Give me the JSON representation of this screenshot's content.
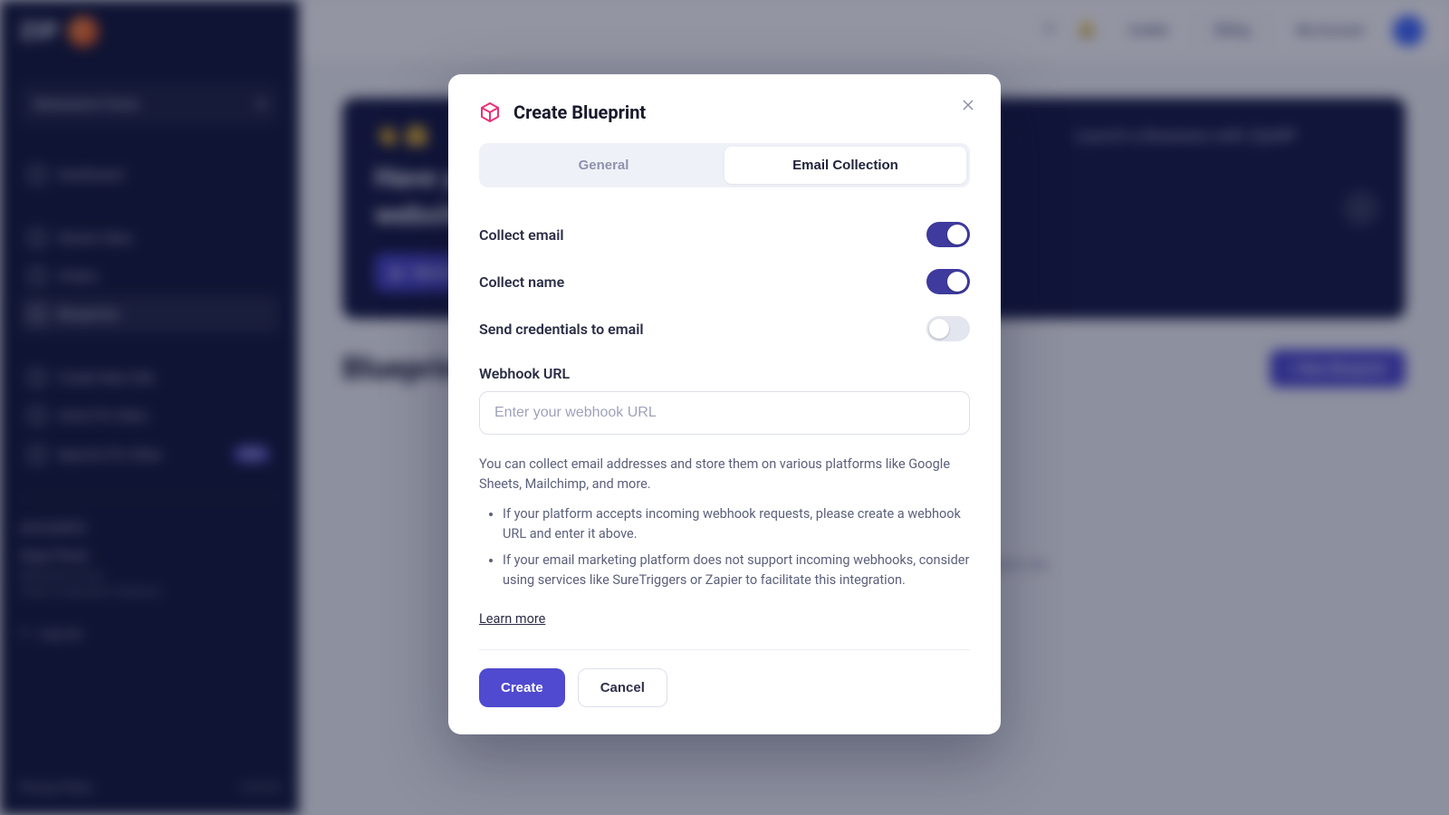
{
  "sidebar": {
    "logo_text": "ZIP",
    "site_selector": "Brainstorm Force",
    "items": [
      {
        "label": "Dashboard"
      },
      {
        "label": "Starter Sites"
      },
      {
        "label": "Orders"
      },
      {
        "label": "Blueprints"
      },
      {
        "label": "Create New Site"
      },
      {
        "label": "Astra Pro Sites"
      },
      {
        "label": "Spectra Pro Sites",
        "badge": "NEW"
      }
    ],
    "account": {
      "section": "ACCOUNTS",
      "name": "Sujay Pawar",
      "org_line1": "Brainstorm Force",
      "org_line2": "(Team of Idea Box Creations)",
      "logout": "Log out"
    },
    "footer": {
      "left": "Privacy Policy",
      "right": "v1.0.12"
    }
  },
  "topbar": {
    "credits": "Credits",
    "billing": "Billing",
    "my_account": "My Account"
  },
  "hero": {
    "emoji": "👋 🤗",
    "line1": "Have you ever wanted to build",
    "line2": "websites using AI?",
    "cta": "Watch Now",
    "right_line": "Launch a Business with ZipWP"
  },
  "section": {
    "title": "Blueprints",
    "new_btn": "+ New Blueprint",
    "empty": "It seems that you haven't created any Blueprint, create one."
  },
  "dialog": {
    "title": "Create Blueprint",
    "tabs": {
      "general": "General",
      "email": "Email Collection",
      "active": "email"
    },
    "toggles": {
      "collect_email": {
        "label": "Collect email",
        "on": true
      },
      "collect_name": {
        "label": "Collect name",
        "on": true
      },
      "send_creds": {
        "label": "Send credentials to email",
        "on": false
      }
    },
    "webhook": {
      "label": "Webhook URL",
      "placeholder": "Enter your webhook URL",
      "value": ""
    },
    "help": {
      "intro": "You can collect email addresses and store them on various platforms like Google Sheets, Mailchimp, and more.",
      "bullet1": "If your platform accepts incoming webhook requests, please create a webhook URL and enter it above.",
      "bullet2": "If your email marketing platform does not support incoming webhooks, consider using services like SureTriggers or Zapier to facilitate this integration.",
      "learn_more": "Learn more"
    },
    "actions": {
      "create": "Create",
      "cancel": "Cancel"
    }
  }
}
